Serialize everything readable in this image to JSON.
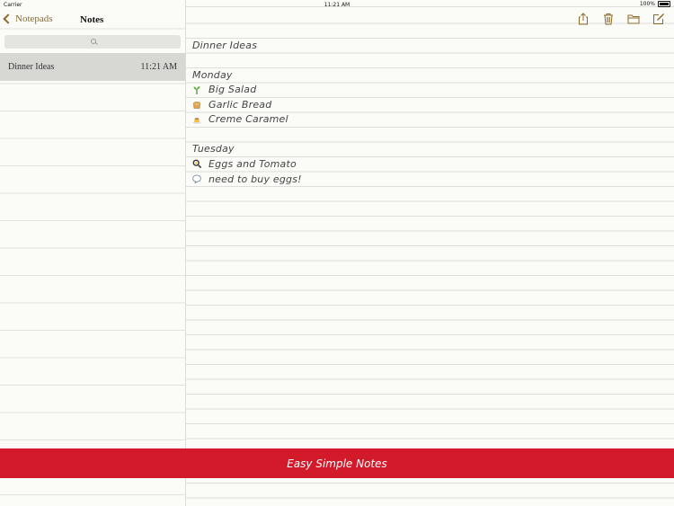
{
  "status_bar": {
    "carrier": "Carrier",
    "time": "11:21 AM",
    "battery": "100%"
  },
  "sidebar": {
    "back_label": "Notepads",
    "title": "Notes",
    "notes": [
      {
        "title": "Dinner Ideas",
        "time": "11:21 AM"
      }
    ]
  },
  "editor": {
    "toolbar": [
      "share-icon",
      "trash-icon",
      "folder-icon",
      "compose-icon"
    ],
    "lines": [
      {
        "text": "Dinner Ideas"
      },
      {
        "text": "Monday"
      },
      {
        "text": "Big Salad",
        "icon": "sprout-icon"
      },
      {
        "text": "Garlic Bread",
        "icon": "bread-icon"
      },
      {
        "text": "Creme Caramel",
        "icon": "custard-icon"
      },
      {
        "text": "Tuesday"
      },
      {
        "text": "Eggs and Tomato",
        "icon": "frying-pan-icon"
      },
      {
        "text": "need to buy eggs!",
        "icon": "speech-bubble-icon"
      }
    ]
  },
  "banner": {
    "text": "Easy Simple Notes"
  },
  "colors": {
    "accent": "#8c6a2a",
    "banner": "#d21a2a",
    "selected_row": "#d7d7d4"
  }
}
